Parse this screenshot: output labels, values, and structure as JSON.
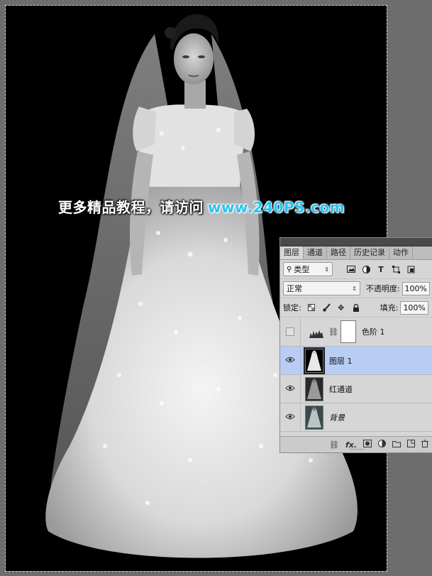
{
  "watermark": {
    "cn_text": "更多精品教程，请访问",
    "url_text": "www.240PS.com",
    "url_color": "#26c4f2"
  },
  "layers_panel": {
    "tabs": [
      "图层",
      "通道",
      "路径",
      "历史记录",
      "动作"
    ],
    "active_tab": "图层",
    "filter": {
      "icon": "search-icon",
      "kind_label": "类型"
    },
    "blend": {
      "mode": "正常",
      "opacity_label": "不透明度:",
      "opacity_value": "100%"
    },
    "lock": {
      "label": "锁定:",
      "fill_label": "填充:",
      "fill_value": "100%"
    },
    "layers": [
      {
        "name": "色阶 1",
        "visible": false,
        "type": "adjustment-levels"
      },
      {
        "name": "图层 1",
        "visible": true,
        "type": "pixel",
        "selected": true
      },
      {
        "name": "红通道",
        "visible": true,
        "type": "pixel"
      },
      {
        "name": "背景",
        "visible": true,
        "type": "background",
        "italic": true
      }
    ],
    "bottom_icons": [
      "link-icon",
      "fx-icon",
      "mask-icon",
      "adjustment-icon",
      "folder-icon",
      "new-layer-icon",
      "trash-icon"
    ],
    "fx_label": "fx."
  },
  "colors": {
    "selected_layer_bg": "#b8cdf3",
    "canvas_bg": "#000000"
  }
}
